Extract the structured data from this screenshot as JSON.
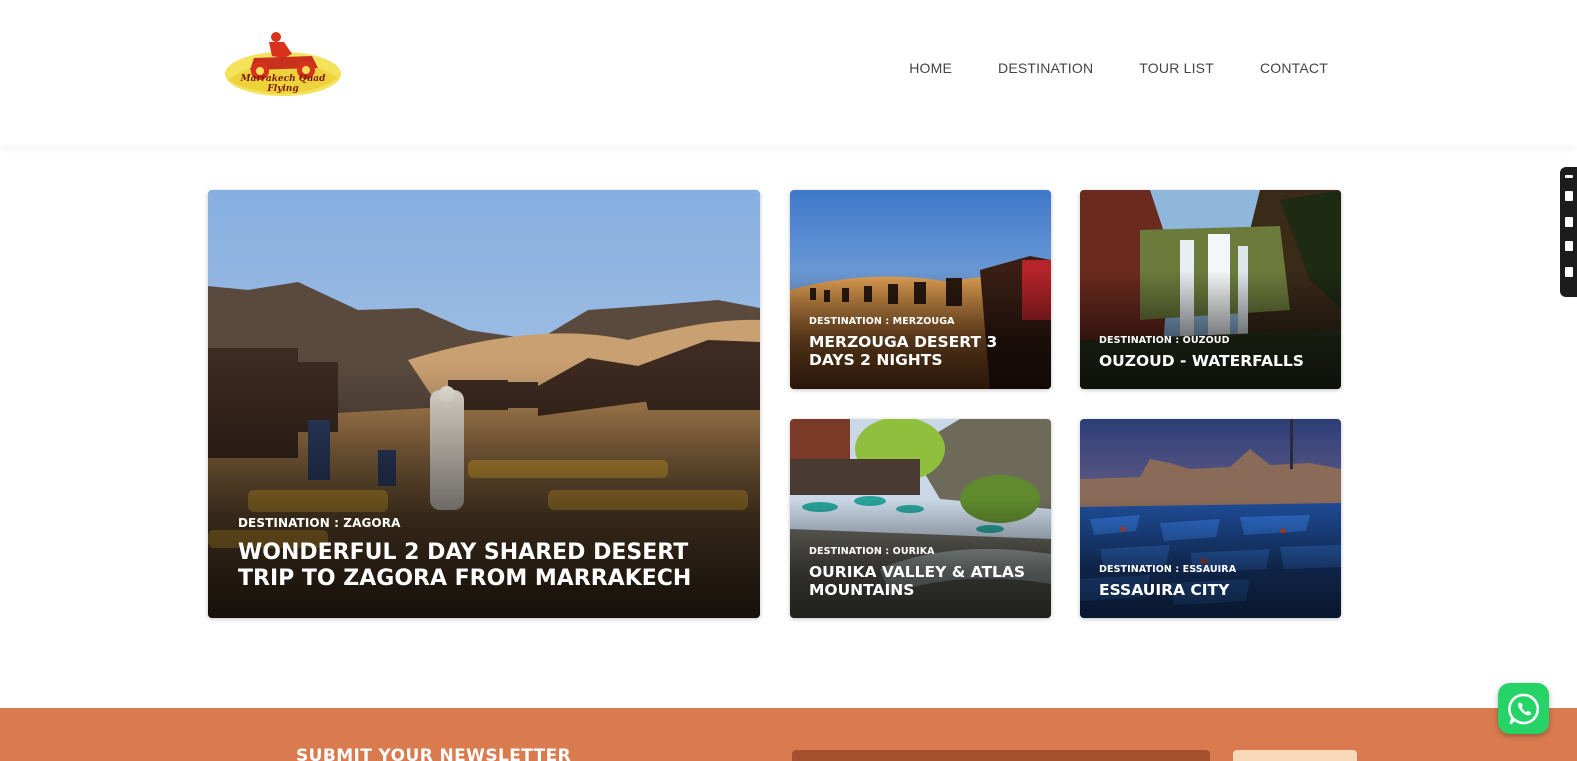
{
  "header": {
    "logo_text_line1": "Marrakech Quad",
    "logo_text_line2": "Flying",
    "nav": [
      {
        "label": "HOME"
      },
      {
        "label": "DESTINATION"
      },
      {
        "label": "TOUR LIST"
      },
      {
        "label": "CONTACT"
      }
    ]
  },
  "cards": [
    {
      "destination": "DESTINATION : ZAGORA",
      "title": "WONDERFUL 2 DAY SHARED DESERT TRIP TO ZAGORA FROM MARRAKECH"
    },
    {
      "destination": "DESTINATION : MERZOUGA",
      "title": "MERZOUGA DESERT 3 DAYS 2 NIGHTS"
    },
    {
      "destination": "DESTINATION : OUZOUD",
      "title": "OUZOUD - WATERFALLS"
    },
    {
      "destination": "DESTINATION : OURIKA",
      "title": "OURIKA VALLEY & ATLAS MOUNTAINS"
    },
    {
      "destination": "DESTINATION : ESSAUIRA",
      "title": "ESSAUIRA CITY"
    }
  ],
  "newsletter": {
    "title": "SUBMIT YOUR NEWSLETTER"
  },
  "colors": {
    "newsletter_bg": "#d97b4f",
    "whatsapp": "#25d366"
  },
  "icons": [
    "logo-quad-icon",
    "whatsapp-icon"
  ]
}
